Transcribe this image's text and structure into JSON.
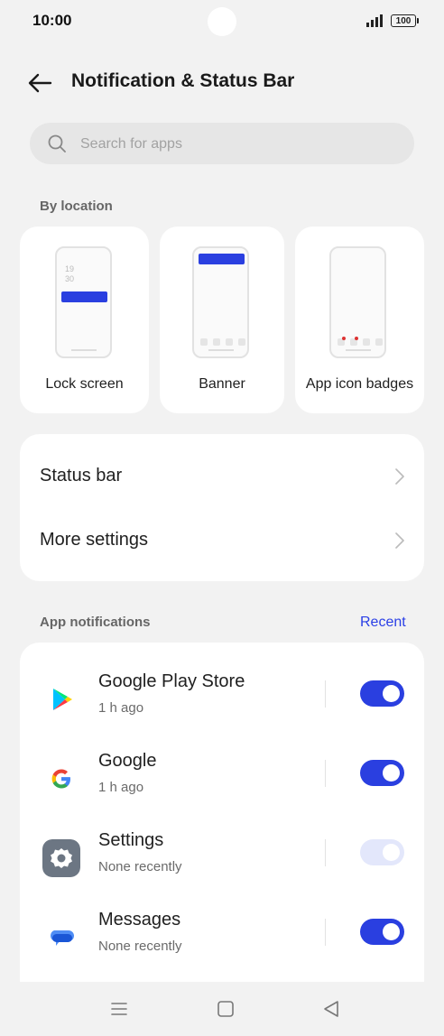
{
  "status_bar": {
    "time": "10:00",
    "battery": "100"
  },
  "header": {
    "title": "Notification & Status Bar"
  },
  "search": {
    "placeholder": "Search for apps",
    "value": ""
  },
  "by_location": {
    "label": "By location",
    "items": [
      {
        "label": "Lock screen",
        "clock_hour": "19",
        "clock_min": "30"
      },
      {
        "label": "Banner"
      },
      {
        "label": "App icon badges"
      }
    ]
  },
  "settings_rows": [
    {
      "label": "Status bar"
    },
    {
      "label": "More settings"
    }
  ],
  "app_notifications": {
    "label": "App notifications",
    "recent_label": "Recent",
    "apps": [
      {
        "name": "Google Play Store",
        "sub": "1 h ago",
        "enabled": true,
        "icon": "google-play-store-icon"
      },
      {
        "name": "Google",
        "sub": "1 h ago",
        "enabled": true,
        "icon": "google-icon"
      },
      {
        "name": "Settings",
        "sub": "None recently",
        "enabled": true,
        "locked": true,
        "icon": "settings-gear-icon"
      },
      {
        "name": "Messages",
        "sub": "None recently",
        "enabled": true,
        "icon": "messages-icon"
      }
    ]
  },
  "colors": {
    "accent": "#2a3fe0",
    "background": "#f2f2f2",
    "card": "#ffffff"
  }
}
